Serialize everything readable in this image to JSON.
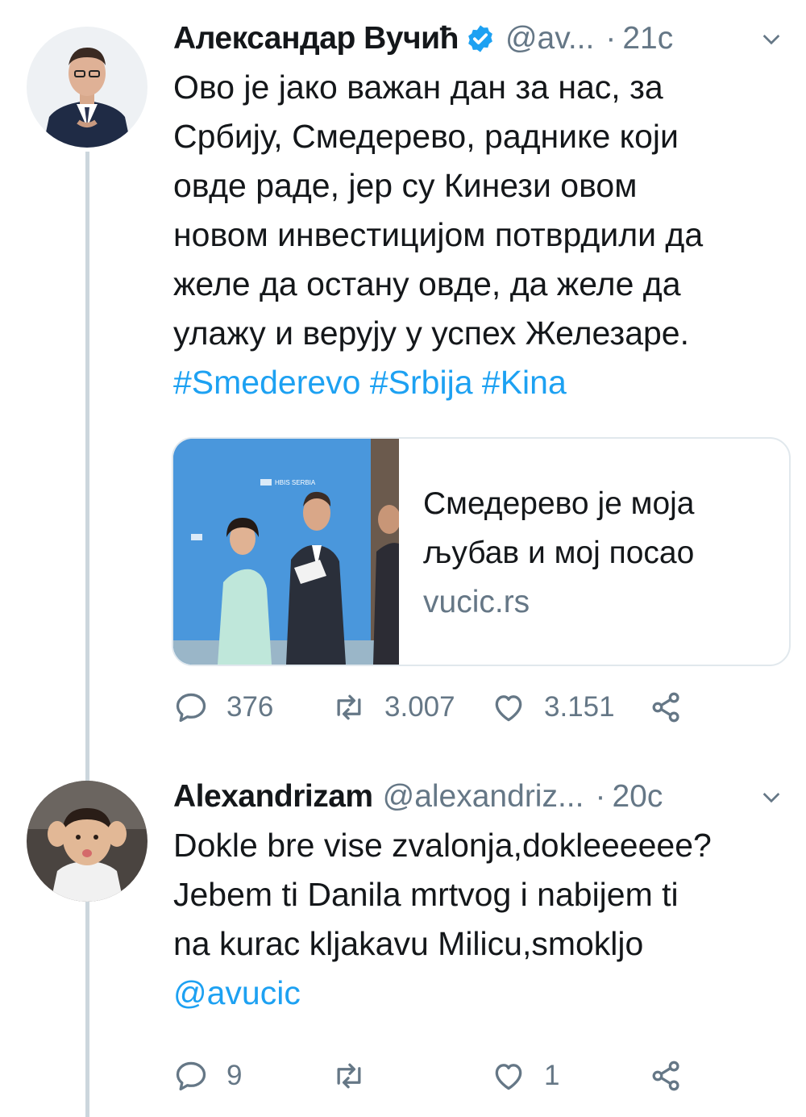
{
  "tweet1": {
    "display_name": "Александар Вучић",
    "handle": "@av...",
    "separator": "·",
    "time": "21с",
    "lines": [
      "Ово је јако важан дан за нас, за",
      "Србију, Смедерево, раднике који",
      "овде раде, јер су Кинези овом",
      "новом инвестицијом потврдили да",
      "желе да остану овде, да желе да",
      "улажу и верују у успех Железаре."
    ],
    "hashtags": [
      "#Smederevo",
      "#Srbija",
      "#Kina"
    ],
    "card": {
      "title_line1": "Смедерево је моја",
      "title_line2": "љубав и мој посао",
      "domain": "vucic.rs",
      "image_banner_text": "HBIS SERBIA"
    },
    "replies": "376",
    "retweets": "3.007",
    "likes": "3.151"
  },
  "tweet2": {
    "display_name": "Alexandrizam",
    "handle": "@alexandriz...",
    "separator": "·",
    "time": "20с",
    "lines": [
      "Dokle bre vise zvalonja,dokleeeeee?",
      "Jebem ti Danila mrtvog i nabijem ti",
      "na kurac kljakavu Milicu,smokljo"
    ],
    "mention": "@avucic",
    "replies": "9",
    "retweets": "",
    "likes": "1"
  },
  "icons": {
    "verified": "verified-badge-icon",
    "caret": "chevron-down-icon",
    "reply": "reply-icon",
    "retweet": "retweet-icon",
    "like": "heart-icon",
    "share": "share-icon"
  },
  "colors": {
    "link": "#1da1f2",
    "secondary": "#657786",
    "thread_line": "#ccd6dd"
  }
}
